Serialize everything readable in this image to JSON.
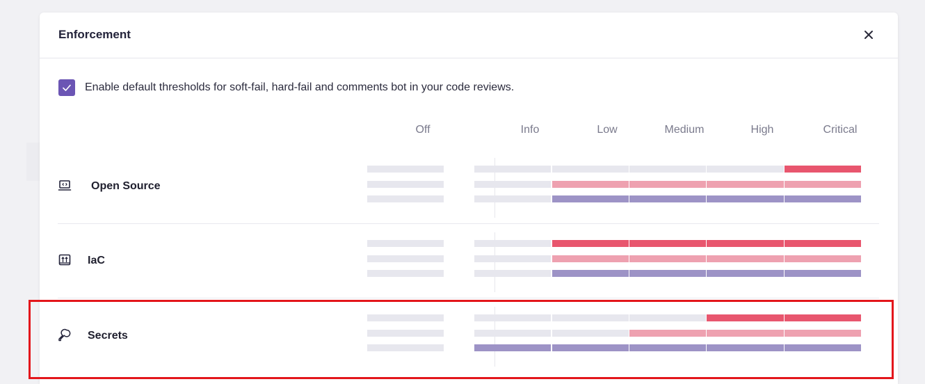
{
  "modal": {
    "title": "Enforcement",
    "close_icon": "close-icon"
  },
  "checkbox": {
    "checked": true,
    "label": "Enable default thresholds for soft-fail, hard-fail and comments bot in your code reviews."
  },
  "columns": [
    "Off",
    "Info",
    "Low",
    "Medium",
    "High",
    "Critical"
  ],
  "colors": {
    "hard_fail": "#e8566e",
    "soft_fail": "#eea1b0",
    "comments": "#9d93c6",
    "empty": "#e7e7ee",
    "accent": "#6b55b4"
  },
  "rows": [
    {
      "name": "open-source",
      "label": "Open Source",
      "icon": "laptop-code-icon",
      "thresholds": {
        "hard_fail": "Critical",
        "soft_fail": "Low",
        "comments": "Low"
      }
    },
    {
      "name": "iac",
      "label": "IaC",
      "icon": "iac-icon",
      "thresholds": {
        "hard_fail": "Low",
        "soft_fail": "Low",
        "comments": "Low"
      }
    },
    {
      "name": "secrets",
      "label": "Secrets",
      "icon": "key-icon",
      "highlighted": true,
      "thresholds": {
        "hard_fail": "High",
        "soft_fail": "Medium",
        "comments": "Info"
      }
    }
  ]
}
